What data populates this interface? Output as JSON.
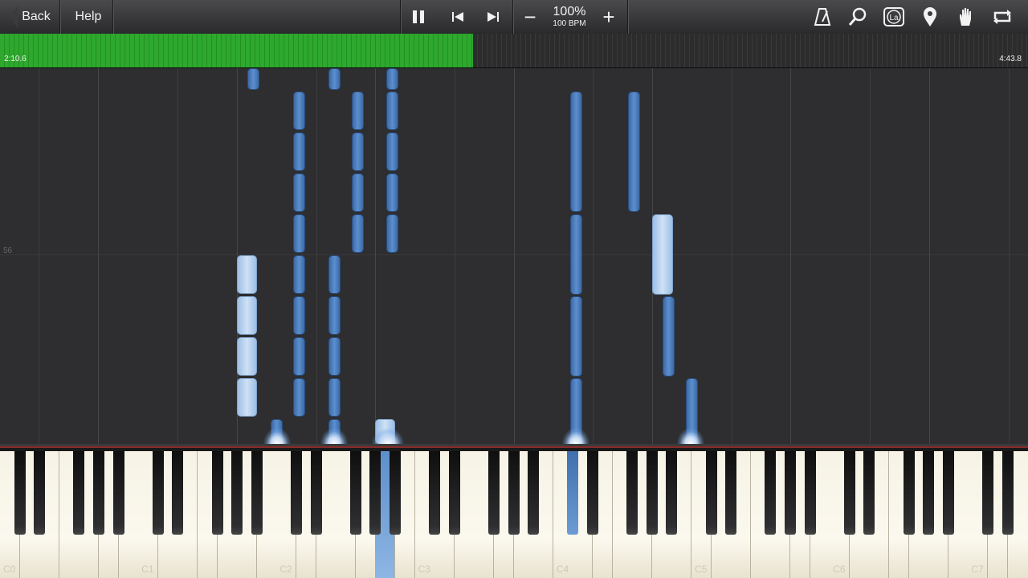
{
  "toolbar": {
    "back_label": "Back",
    "help_label": "Help",
    "pause_icon": "pause-icon",
    "prev_icon": "skip-back-icon",
    "next_icon": "skip-forward-icon",
    "zoom_out_symbol": "−",
    "zoom_in_symbol": "+",
    "tempo_percent": "100%",
    "tempo_bpm": "100 BPM",
    "right_icons": [
      "metronome-icon",
      "search-icon",
      "label-icon",
      "location-pin-icon",
      "hand-icon",
      "loop-icon"
    ],
    "label_icon_text": "La"
  },
  "progress": {
    "current_time": "2:10.6",
    "total_time": "4:43.8",
    "fraction": 0.46
  },
  "roll": {
    "measure_number": "56"
  },
  "keyboard": {
    "octave_labels": [
      "C0",
      "C1",
      "C2",
      "C3",
      "C4",
      "C5",
      "C6",
      "C7"
    ]
  },
  "colors": {
    "progress_green": "#2ea82e",
    "note_blue": "#4a7dbf",
    "note_light": "#b5d1ee",
    "white_key": "#f7f4e8",
    "background": "#2e2e30"
  }
}
